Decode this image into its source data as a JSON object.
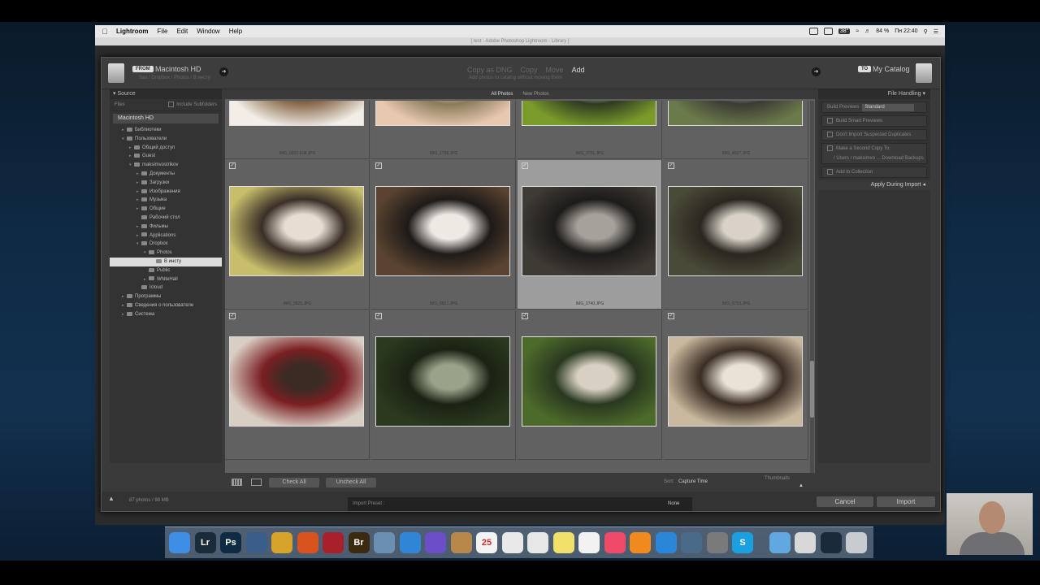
{
  "menubar": {
    "app": "Lightroom",
    "items": [
      "File",
      "Edit",
      "Window",
      "Help"
    ],
    "battery": "84 %",
    "clock": "Пн 22:40",
    "badge": "38°"
  },
  "window_title": "[ test - Adobe Photoshop Lightroom - Library ]",
  "header": {
    "from_tag": "FROM",
    "from_title": "Macintosh HD",
    "from_path": "Sas / Dropbox / Photos / В инсту",
    "modes": [
      "Copy as DNG",
      "Copy",
      "Move",
      "Add"
    ],
    "active_mode": "Add",
    "mode_sub": "Add photos to catalog without moving them",
    "to_tag": "TO",
    "to_title": "My Catalog"
  },
  "source": {
    "title": "Source",
    "files_label": "Files",
    "include_sub": "Include Subfolders",
    "drive": "Macintosh HD",
    "tree": [
      {
        "label": "Библиотеки",
        "level": 1,
        "tw": "▸"
      },
      {
        "label": "Пользователи",
        "level": 1,
        "tw": "▾"
      },
      {
        "label": "Общий доступ",
        "level": 2,
        "tw": "▸"
      },
      {
        "label": "Guest",
        "level": 2,
        "tw": "▸"
      },
      {
        "label": "maksimvostrikov",
        "level": 2,
        "tw": "▾"
      },
      {
        "label": "Документы",
        "level": 3,
        "tw": "▸"
      },
      {
        "label": "Загрузки",
        "level": 3,
        "tw": "▸"
      },
      {
        "label": "Изображения",
        "level": 3,
        "tw": "▸"
      },
      {
        "label": "Музыка",
        "level": 3,
        "tw": "▸"
      },
      {
        "label": "Общие",
        "level": 3,
        "tw": "▸"
      },
      {
        "label": "Рабочий стол",
        "level": 3,
        "tw": ""
      },
      {
        "label": "Фильмы",
        "level": 3,
        "tw": "▸"
      },
      {
        "label": "Applications",
        "level": 3,
        "tw": "▸"
      },
      {
        "label": "Dropbox",
        "level": 3,
        "tw": "▾"
      },
      {
        "label": "Photos",
        "level": 4,
        "tw": "▾"
      },
      {
        "label": "В инсту",
        "level": 5,
        "tw": "",
        "sel": true
      },
      {
        "label": "Public",
        "level": 4,
        "tw": ""
      },
      {
        "label": "WhiteHall",
        "level": 4,
        "tw": "▸"
      },
      {
        "label": "Icloud",
        "level": 3,
        "tw": ""
      },
      {
        "label": "Программы",
        "level": 1,
        "tw": "▸"
      },
      {
        "label": "Сведения о пользователе",
        "level": 1,
        "tw": "▸"
      },
      {
        "label": "Система",
        "level": 1,
        "tw": "▸"
      }
    ]
  },
  "tabs": [
    "All Photos",
    "New Photos"
  ],
  "active_tab": "All Photos",
  "grid": [
    {
      "fn": "IMG_0352-Edit.JPG",
      "checked": false,
      "colors": [
        "#f2ede6",
        "#2a211b",
        "#8a6b4e"
      ]
    },
    {
      "fn": "IMG_1798.JPG",
      "checked": false,
      "colors": [
        "#e8c9b0",
        "#f3e4d4",
        "#8a7a5a"
      ]
    },
    {
      "fn": "IMG_3791.JPG",
      "checked": false,
      "colors": [
        "#7a9b2a",
        "#ece6e0",
        "#2e3a22"
      ]
    },
    {
      "fn": "IMG_4067.JPG",
      "checked": false,
      "colors": [
        "#6a7a4a",
        "#c9c5bd",
        "#3b3a34"
      ]
    },
    {
      "fn": "IMG_0625.JPG",
      "checked": true,
      "colors": [
        "#c7bd6a",
        "#e8ddd2",
        "#3a2f28"
      ]
    },
    {
      "fn": "IMG_0827.JPG",
      "checked": true,
      "colors": [
        "#5a4330",
        "#efe9e4",
        "#1d1a18"
      ]
    },
    {
      "fn": "IMG_0740.JPG",
      "checked": true,
      "colors": [
        "#3e3a34",
        "#a6a199",
        "#1d1b19"
      ],
      "sel": true
    },
    {
      "fn": "IMG_0753.JPG",
      "checked": true,
      "colors": [
        "#4a4a38",
        "#d8d2c8",
        "#2a2720"
      ]
    },
    {
      "fn": "",
      "checked": true,
      "colors": [
        "#d9cec4",
        "#3b2b24",
        "#7a1f22"
      ]
    },
    {
      "fn": "",
      "checked": true,
      "colors": [
        "#2b3a1e",
        "#9aa28a",
        "#1a2214"
      ]
    },
    {
      "fn": "",
      "checked": true,
      "colors": [
        "#4c6a2a",
        "#d8d0c2",
        "#2a3820"
      ]
    },
    {
      "fn": "",
      "checked": true,
      "colors": [
        "#c9b89e",
        "#e9e2d6",
        "#3a2d24"
      ]
    }
  ],
  "toolbar": {
    "check_all": "Check All",
    "uncheck_all": "Uncheck All",
    "sort_label": "Sort:",
    "sort_value": "Capture Time",
    "thumbnails": "Thumbnails"
  },
  "file_handling": {
    "title": "File Handling",
    "build_previews_label": "Build Previews",
    "build_previews_value": "Standard",
    "smart_previews": "Build Smart Previews",
    "no_duplicates": "Don't Import Suspected Duplicates",
    "second_copy": "Make a Second Copy To:",
    "second_copy_path": "/ Users / maksimvo ... Download Backups",
    "add_collection": "Add to Collection",
    "apply_during": "Apply During Import"
  },
  "footer": {
    "count": "87 photos / 98 MB",
    "preset_label": "Import Preset :",
    "preset_value": "None",
    "cancel": "Cancel",
    "import": "Import"
  },
  "dock": [
    {
      "name": "finder-icon",
      "bg": "#3f8ee6",
      "t": ""
    },
    {
      "name": "lightroom-icon",
      "bg": "#1c2b3a",
      "t": "Lr"
    },
    {
      "name": "photoshop-icon",
      "bg": "#0f2b44",
      "t": "Ps"
    },
    {
      "name": "system-globe-icon",
      "bg": "#3a5e8a",
      "t": ""
    },
    {
      "name": "chrome-icon",
      "bg": "#d7a32a",
      "t": ""
    },
    {
      "name": "firefox-icon",
      "bg": "#d9531e",
      "t": ""
    },
    {
      "name": "photobooth-icon",
      "bg": "#a8202a",
      "t": ""
    },
    {
      "name": "bridge-icon",
      "bg": "#3a2a10",
      "t": "Br"
    },
    {
      "name": "preview-icon",
      "bg": "#6a8fb2",
      "t": ""
    },
    {
      "name": "safari-icon",
      "bg": "#2f86d6",
      "t": ""
    },
    {
      "name": "imovie-star-icon",
      "bg": "#6a4fc8",
      "t": ""
    },
    {
      "name": "contacts-icon",
      "bg": "#b8874a",
      "t": ""
    },
    {
      "name": "calendar-icon",
      "bg": "#f3f3f3",
      "t": "25"
    },
    {
      "name": "notes-icon",
      "bg": "#e9e9e9",
      "t": ""
    },
    {
      "name": "reminders-icon",
      "bg": "#e7e7e7",
      "t": ""
    },
    {
      "name": "stickies-icon",
      "bg": "#f1e06a",
      "t": ""
    },
    {
      "name": "photos-icon",
      "bg": "#f2f2f2",
      "t": ""
    },
    {
      "name": "itunes-icon",
      "bg": "#f04a6a",
      "t": ""
    },
    {
      "name": "ibooks-icon",
      "bg": "#f08a1e",
      "t": ""
    },
    {
      "name": "app-store-icon",
      "bg": "#2a86d8",
      "t": ""
    },
    {
      "name": "image-capture-icon",
      "bg": "#4a6a8a",
      "t": ""
    },
    {
      "name": "system-preferences-icon",
      "bg": "#7a7a7a",
      "t": ""
    },
    {
      "name": "skype-icon",
      "bg": "#1aa0e0",
      "t": "S"
    },
    {
      "name": "folder-icon",
      "bg": "#5fa8e0",
      "t": ""
    },
    {
      "name": "documents-icon",
      "bg": "#d8d8d8",
      "t": ""
    },
    {
      "name": "screen-icon",
      "bg": "#1a2a3a",
      "t": ""
    },
    {
      "name": "trash-icon",
      "bg": "#c8ccd0",
      "t": ""
    }
  ]
}
